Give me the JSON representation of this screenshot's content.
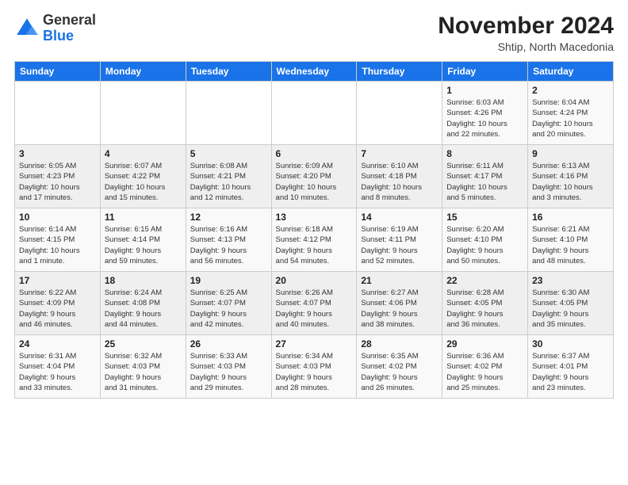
{
  "logo": {
    "general": "General",
    "blue": "Blue"
  },
  "header": {
    "month_year": "November 2024",
    "location": "Shtip, North Macedonia"
  },
  "weekdays": [
    "Sunday",
    "Monday",
    "Tuesday",
    "Wednesday",
    "Thursday",
    "Friday",
    "Saturday"
  ],
  "weeks": [
    [
      {
        "day": "",
        "info": ""
      },
      {
        "day": "",
        "info": ""
      },
      {
        "day": "",
        "info": ""
      },
      {
        "day": "",
        "info": ""
      },
      {
        "day": "",
        "info": ""
      },
      {
        "day": "1",
        "info": "Sunrise: 6:03 AM\nSunset: 4:26 PM\nDaylight: 10 hours\nand 22 minutes."
      },
      {
        "day": "2",
        "info": "Sunrise: 6:04 AM\nSunset: 4:24 PM\nDaylight: 10 hours\nand 20 minutes."
      }
    ],
    [
      {
        "day": "3",
        "info": "Sunrise: 6:05 AM\nSunset: 4:23 PM\nDaylight: 10 hours\nand 17 minutes."
      },
      {
        "day": "4",
        "info": "Sunrise: 6:07 AM\nSunset: 4:22 PM\nDaylight: 10 hours\nand 15 minutes."
      },
      {
        "day": "5",
        "info": "Sunrise: 6:08 AM\nSunset: 4:21 PM\nDaylight: 10 hours\nand 12 minutes."
      },
      {
        "day": "6",
        "info": "Sunrise: 6:09 AM\nSunset: 4:20 PM\nDaylight: 10 hours\nand 10 minutes."
      },
      {
        "day": "7",
        "info": "Sunrise: 6:10 AM\nSunset: 4:18 PM\nDaylight: 10 hours\nand 8 minutes."
      },
      {
        "day": "8",
        "info": "Sunrise: 6:11 AM\nSunset: 4:17 PM\nDaylight: 10 hours\nand 5 minutes."
      },
      {
        "day": "9",
        "info": "Sunrise: 6:13 AM\nSunset: 4:16 PM\nDaylight: 10 hours\nand 3 minutes."
      }
    ],
    [
      {
        "day": "10",
        "info": "Sunrise: 6:14 AM\nSunset: 4:15 PM\nDaylight: 10 hours\nand 1 minute."
      },
      {
        "day": "11",
        "info": "Sunrise: 6:15 AM\nSunset: 4:14 PM\nDaylight: 9 hours\nand 59 minutes."
      },
      {
        "day": "12",
        "info": "Sunrise: 6:16 AM\nSunset: 4:13 PM\nDaylight: 9 hours\nand 56 minutes."
      },
      {
        "day": "13",
        "info": "Sunrise: 6:18 AM\nSunset: 4:12 PM\nDaylight: 9 hours\nand 54 minutes."
      },
      {
        "day": "14",
        "info": "Sunrise: 6:19 AM\nSunset: 4:11 PM\nDaylight: 9 hours\nand 52 minutes."
      },
      {
        "day": "15",
        "info": "Sunrise: 6:20 AM\nSunset: 4:10 PM\nDaylight: 9 hours\nand 50 minutes."
      },
      {
        "day": "16",
        "info": "Sunrise: 6:21 AM\nSunset: 4:10 PM\nDaylight: 9 hours\nand 48 minutes."
      }
    ],
    [
      {
        "day": "17",
        "info": "Sunrise: 6:22 AM\nSunset: 4:09 PM\nDaylight: 9 hours\nand 46 minutes."
      },
      {
        "day": "18",
        "info": "Sunrise: 6:24 AM\nSunset: 4:08 PM\nDaylight: 9 hours\nand 44 minutes."
      },
      {
        "day": "19",
        "info": "Sunrise: 6:25 AM\nSunset: 4:07 PM\nDaylight: 9 hours\nand 42 minutes."
      },
      {
        "day": "20",
        "info": "Sunrise: 6:26 AM\nSunset: 4:07 PM\nDaylight: 9 hours\nand 40 minutes."
      },
      {
        "day": "21",
        "info": "Sunrise: 6:27 AM\nSunset: 4:06 PM\nDaylight: 9 hours\nand 38 minutes."
      },
      {
        "day": "22",
        "info": "Sunrise: 6:28 AM\nSunset: 4:05 PM\nDaylight: 9 hours\nand 36 minutes."
      },
      {
        "day": "23",
        "info": "Sunrise: 6:30 AM\nSunset: 4:05 PM\nDaylight: 9 hours\nand 35 minutes."
      }
    ],
    [
      {
        "day": "24",
        "info": "Sunrise: 6:31 AM\nSunset: 4:04 PM\nDaylight: 9 hours\nand 33 minutes."
      },
      {
        "day": "25",
        "info": "Sunrise: 6:32 AM\nSunset: 4:03 PM\nDaylight: 9 hours\nand 31 minutes."
      },
      {
        "day": "26",
        "info": "Sunrise: 6:33 AM\nSunset: 4:03 PM\nDaylight: 9 hours\nand 29 minutes."
      },
      {
        "day": "27",
        "info": "Sunrise: 6:34 AM\nSunset: 4:03 PM\nDaylight: 9 hours\nand 28 minutes."
      },
      {
        "day": "28",
        "info": "Sunrise: 6:35 AM\nSunset: 4:02 PM\nDaylight: 9 hours\nand 26 minutes."
      },
      {
        "day": "29",
        "info": "Sunrise: 6:36 AM\nSunset: 4:02 PM\nDaylight: 9 hours\nand 25 minutes."
      },
      {
        "day": "30",
        "info": "Sunrise: 6:37 AM\nSunset: 4:01 PM\nDaylight: 9 hours\nand 23 minutes."
      }
    ]
  ]
}
